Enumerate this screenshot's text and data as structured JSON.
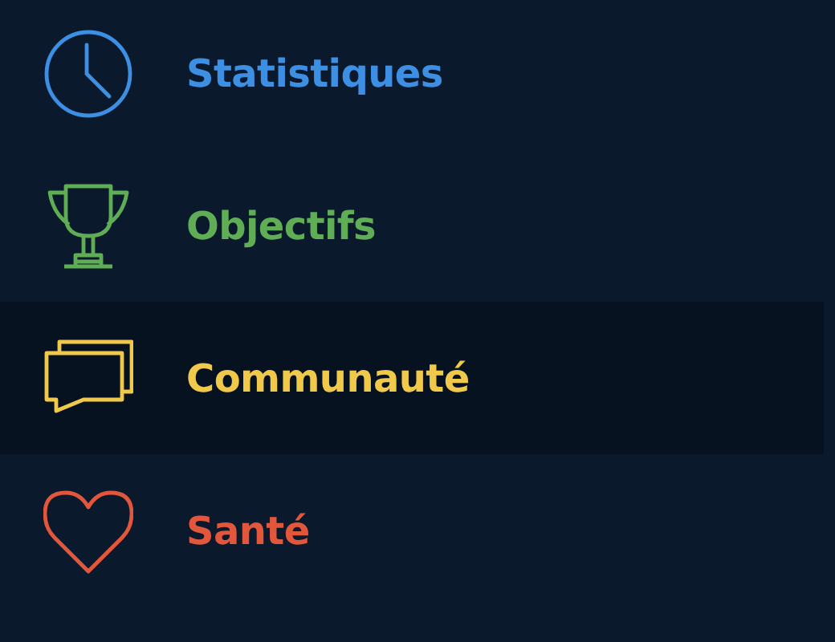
{
  "menu": {
    "items": [
      {
        "label": "Statistiques",
        "color": "#3d8fe3",
        "selected": false
      },
      {
        "label": "Objectifs",
        "color": "#5fae55",
        "selected": false
      },
      {
        "label": "Communauté",
        "color": "#f0c94a",
        "selected": true
      },
      {
        "label": "Santé",
        "color": "#e2573c",
        "selected": false
      }
    ]
  }
}
